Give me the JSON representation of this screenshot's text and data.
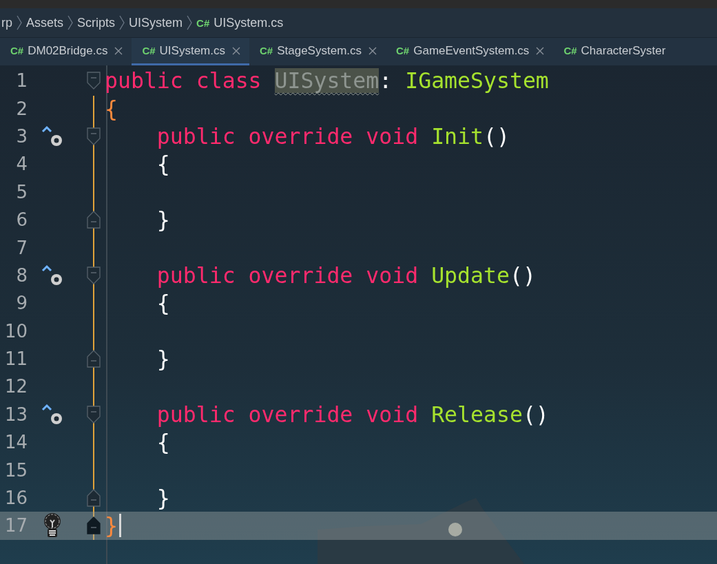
{
  "breadcrumb": [
    {
      "label": "rp"
    },
    {
      "label": "Assets"
    },
    {
      "label": "Scripts"
    },
    {
      "label": "UISystem"
    },
    {
      "label": "UISystem.cs",
      "badge": "C#"
    }
  ],
  "tabs": [
    {
      "badge": "C#",
      "label": "DM02Bridge.cs",
      "selected": false,
      "closable": true
    },
    {
      "badge": "C#",
      "label": "UISystem.cs",
      "selected": true,
      "closable": true
    },
    {
      "badge": "C#",
      "label": "StageSystem.cs",
      "selected": false,
      "closable": true
    },
    {
      "badge": "C#",
      "label": "GameEventSystem.cs",
      "selected": false,
      "closable": true
    },
    {
      "badge": "C#",
      "label": "CharacterSyster",
      "selected": false,
      "closable": false
    }
  ],
  "lines": [
    {
      "number": "1",
      "current": false,
      "fold": {
        "kind": "start"
      },
      "tokens": [
        {
          "text": "public class ",
          "kind": "keyword"
        },
        {
          "text": "UISystem",
          "kind": "highlight"
        },
        {
          "text": ": ",
          "kind": "plain"
        },
        {
          "text": "IGameSystem",
          "kind": "type"
        }
      ]
    },
    {
      "number": "2",
      "current": false,
      "tokens": [
        {
          "text": "{",
          "kind": "outer-brace"
        }
      ]
    },
    {
      "number": "3",
      "current": false,
      "fold": {
        "kind": "start"
      },
      "gutter_icon": {
        "kind": "override"
      },
      "tokens": [
        {
          "text": "    public override void ",
          "kind": "keyword"
        },
        {
          "text": "Init",
          "kind": "type"
        },
        {
          "text": "()",
          "kind": "plain"
        }
      ]
    },
    {
      "number": "4",
      "current": false,
      "tokens": [
        {
          "text": "    {",
          "kind": "plain"
        }
      ]
    },
    {
      "number": "5",
      "current": false
    },
    {
      "number": "6",
      "current": false,
      "fold": {
        "kind": "end"
      },
      "tokens": [
        {
          "text": "    }",
          "kind": "plain"
        }
      ]
    },
    {
      "number": "7",
      "current": false
    },
    {
      "number": "8",
      "current": false,
      "fold": {
        "kind": "start"
      },
      "gutter_icon": {
        "kind": "override"
      },
      "tokens": [
        {
          "text": "    public override void ",
          "kind": "keyword"
        },
        {
          "text": "Update",
          "kind": "type"
        },
        {
          "text": "()",
          "kind": "plain"
        }
      ]
    },
    {
      "number": "9",
      "current": false,
      "tokens": [
        {
          "text": "    {",
          "kind": "plain"
        }
      ]
    },
    {
      "number": "10",
      "current": false
    },
    {
      "number": "11",
      "current": false,
      "fold": {
        "kind": "end"
      },
      "tokens": [
        {
          "text": "    }",
          "kind": "plain"
        }
      ]
    },
    {
      "number": "12",
      "current": false
    },
    {
      "number": "13",
      "current": false,
      "fold": {
        "kind": "start"
      },
      "gutter_icon": {
        "kind": "override"
      },
      "tokens": [
        {
          "text": "    public override void ",
          "kind": "keyword"
        },
        {
          "text": "Release",
          "kind": "type"
        },
        {
          "text": "()",
          "kind": "plain"
        }
      ]
    },
    {
      "number": "14",
      "current": false,
      "tokens": [
        {
          "text": "    {",
          "kind": "plain"
        }
      ]
    },
    {
      "number": "15",
      "current": false
    },
    {
      "number": "16",
      "current": false,
      "fold": {
        "kind": "end"
      },
      "tokens": [
        {
          "text": "    }",
          "kind": "plain"
        }
      ]
    },
    {
      "number": "17",
      "current": true,
      "fold": {
        "kind": "end"
      },
      "gutter_icon": {
        "kind": "bulb"
      },
      "tokens": [
        {
          "text": "}",
          "kind": "outer-brace"
        }
      ]
    }
  ]
}
